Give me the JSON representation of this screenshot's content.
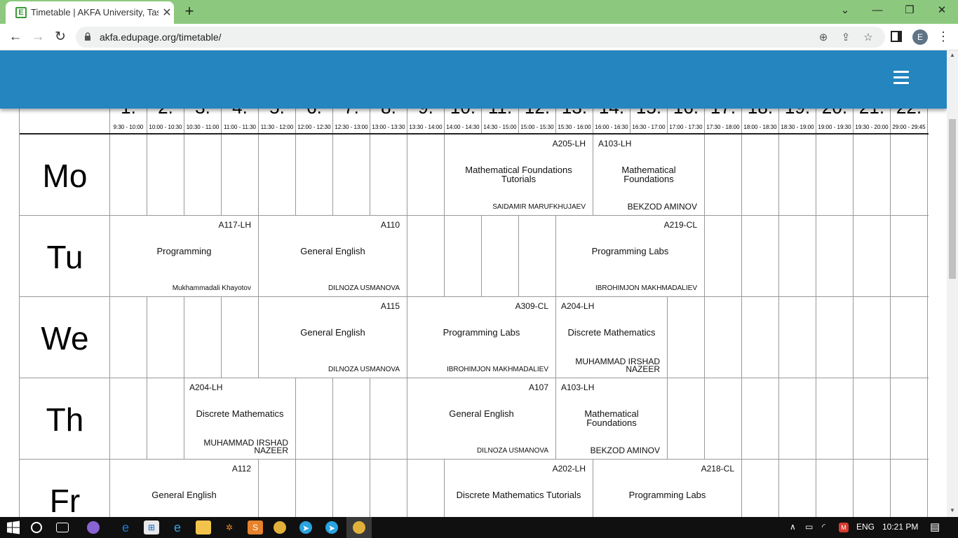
{
  "browser": {
    "tab_title": "Timetable | AKFA University, Tashkent",
    "url": "akfa.edupage.org/timetable/",
    "avatar_letter": "E",
    "favicon_letter": "E"
  },
  "periods": [
    {
      "num": "1.",
      "time": "9:30 - 10:00"
    },
    {
      "num": "2.",
      "time": "10:00 - 10:30"
    },
    {
      "num": "3.",
      "time": "10:30 - 11:00"
    },
    {
      "num": "4.",
      "time": "11:00 - 11:30"
    },
    {
      "num": "5.",
      "time": "11:30 - 12:00"
    },
    {
      "num": "6.",
      "time": "12:00 - 12:30"
    },
    {
      "num": "7.",
      "time": "12:30 - 13:00"
    },
    {
      "num": "8.",
      "time": "13:00 - 13:30"
    },
    {
      "num": "9.",
      "time": "13:30 - 14:00"
    },
    {
      "num": "10.",
      "time": "14:00 - 14:30"
    },
    {
      "num": "11.",
      "time": "14:30 - 15:00"
    },
    {
      "num": "12.",
      "time": "15:00 - 15:30"
    },
    {
      "num": "13.",
      "time": "15:30 - 16:00"
    },
    {
      "num": "14.",
      "time": "16:00 - 16:30"
    },
    {
      "num": "15.",
      "time": "16:30 - 17:00"
    },
    {
      "num": "16.",
      "time": "17:00 - 17:30"
    },
    {
      "num": "17.",
      "time": "17:30 - 18:00"
    },
    {
      "num": "18.",
      "time": "18:00 - 18:30"
    },
    {
      "num": "19.",
      "time": "18:30 - 19:00"
    },
    {
      "num": "20.",
      "time": "19:00 - 19:30"
    },
    {
      "num": "21.",
      "time": "19:30 - 20:00"
    },
    {
      "num": "22.",
      "time": "29:00 - 29:45"
    }
  ],
  "days": [
    "Mo",
    "Tu",
    "We",
    "Th",
    "Fr"
  ],
  "lessons": [
    {
      "day": 0,
      "start": 10,
      "span": 4,
      "room": "A205-LH",
      "room_side": "r",
      "subject": "Mathematical Foundations Tutorials",
      "teacher": "SAIDAMIR MARUFKHUJAEV",
      "teacher_big": false
    },
    {
      "day": 0,
      "start": 14,
      "span": 3,
      "room": "A103-LH",
      "room_side": "l",
      "subject": "Mathematical Foundations",
      "teacher": "BEKZOD AMINOV",
      "teacher_big": true
    },
    {
      "day": 1,
      "start": 1,
      "span": 4,
      "room": "A117-LH",
      "room_side": "r",
      "subject": "Programming",
      "teacher": "Mukhammadali Khayotov",
      "teacher_big": false
    },
    {
      "day": 1,
      "start": 5,
      "span": 4,
      "room": "A110",
      "room_side": "r",
      "subject": "General English",
      "teacher": "DILNOZA USMANOVA",
      "teacher_big": false
    },
    {
      "day": 1,
      "start": 13,
      "span": 4,
      "room": "A219-CL",
      "room_side": "r",
      "subject": "Programming Labs",
      "teacher": "IBROHIMJON MAKHMADALIEV",
      "teacher_big": false
    },
    {
      "day": 2,
      "start": 5,
      "span": 4,
      "room": "A115",
      "room_side": "r",
      "subject": "General English",
      "teacher": "DILNOZA USMANOVA",
      "teacher_big": false
    },
    {
      "day": 2,
      "start": 9,
      "span": 4,
      "room": "A309-CL",
      "room_side": "r",
      "subject": "Programming Labs",
      "teacher": "IBROHIMJON MAKHMADALIEV",
      "teacher_big": false
    },
    {
      "day": 2,
      "start": 13,
      "span": 3,
      "room": "A204-LH",
      "room_side": "l",
      "subject": "Discrete Mathematics",
      "teacher": "MUHAMMAD IRSHAD NAZEER",
      "teacher_big": true
    },
    {
      "day": 3,
      "start": 3,
      "span": 3,
      "room": "A204-LH",
      "room_side": "l",
      "subject": "Discrete Mathematics",
      "teacher": "MUHAMMAD IRSHAD NAZEER",
      "teacher_big": true
    },
    {
      "day": 3,
      "start": 9,
      "span": 4,
      "room": "A107",
      "room_side": "r",
      "subject": "General English",
      "teacher": "DILNOZA USMANOVA",
      "teacher_big": false
    },
    {
      "day": 3,
      "start": 13,
      "span": 3,
      "room": "A103-LH",
      "room_side": "l",
      "subject": "Mathematical Foundations",
      "teacher": "BEKZOD AMINOV",
      "teacher_big": true
    },
    {
      "day": 4,
      "start": 1,
      "span": 4,
      "room": "A112",
      "room_side": "r",
      "subject": "General English",
      "teacher": "",
      "teacher_big": false
    },
    {
      "day": 4,
      "start": 10,
      "span": 4,
      "room": "A202-LH",
      "room_side": "r",
      "subject": "Discrete Mathematics Tutorials",
      "teacher": "",
      "teacher_big": false
    },
    {
      "day": 4,
      "start": 14,
      "span": 4,
      "room": "A218-CL",
      "room_side": "r",
      "subject": "Programming Labs",
      "teacher": "",
      "teacher_big": false
    }
  ],
  "taskbar": {
    "language": "ENG",
    "time": "10:21 PM"
  },
  "colors": {
    "tabbar": "#8cc97e",
    "site_header": "#2485bf",
    "taskbar": "#101010"
  }
}
